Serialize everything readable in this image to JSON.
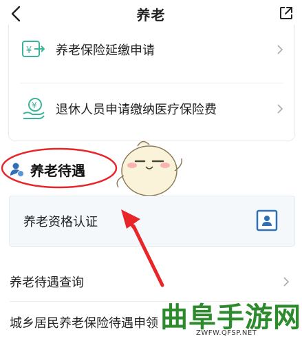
{
  "header": {
    "title": "养老",
    "back_icon": "chevron-left-icon",
    "share_icon": "share-icon"
  },
  "top_card": {
    "items": [
      {
        "label": "养老保险延缴申请",
        "icon": "money-transfer-icon"
      },
      {
        "label": "退休人员申请缴纳医疗保险费",
        "icon": "yuan-hand-icon"
      }
    ]
  },
  "section": {
    "title": "养老待遇",
    "icon": "person-coin-icon"
  },
  "cert_card": {
    "label": "养老资格认证",
    "icon": "id-card-icon"
  },
  "list": [
    {
      "label": "养老待遇查询"
    },
    {
      "label": "城乡居民养老保险待遇申领"
    }
  ],
  "watermark": {
    "text": "曲阜手游网",
    "url": "ZWFW.QFSP.NET"
  },
  "colors": {
    "accent_green": "#3bb59a",
    "annotation_red": "#e8262a",
    "watermark_green": "#2d8a2d"
  }
}
